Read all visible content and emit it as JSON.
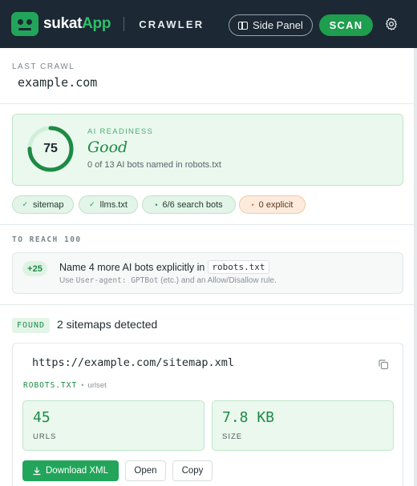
{
  "header": {
    "brand_prefix": "sukat",
    "brand_suffix": "App",
    "section_title": "CRAWLER",
    "side_panel_label": "Side Panel",
    "scan_label": "SCAN",
    "icons": [
      "robot-logo-icon",
      "side-panel-icon",
      "gear-icon"
    ],
    "accent_color": "#22a55a",
    "background_color": "#1c2833"
  },
  "last_crawl": {
    "label": "LAST CRAWL",
    "value": "example.com"
  },
  "readiness": {
    "score": "75",
    "score_fraction": 0.75,
    "label": "AI READINESS",
    "rating": "Good",
    "detail": "0 of 13 AI bots named in robots.txt"
  },
  "chips": [
    {
      "mark": "✓",
      "label": "sitemap",
      "status": "ok"
    },
    {
      "mark": "✓",
      "label": "llms.txt",
      "status": "ok"
    },
    {
      "mark": "•",
      "label": "6/6 search bots",
      "status": "ok"
    },
    {
      "mark": "•",
      "label": "0 explicit",
      "status": "warn"
    }
  ],
  "reach": {
    "label": "TO REACH 100",
    "points": "+25",
    "text": "Name 4 more AI bots explicitly in",
    "code": "robots.txt",
    "hint_prefix": "Use ",
    "hint_code": "User-agent: GPTBot",
    "hint_suffix": " (etc.) and an Allow/Disallow rule."
  },
  "sitemaps": {
    "badge": "FOUND",
    "title": "2 sitemaps detected",
    "items": [
      {
        "url": "https://example.com/sitemap.xml",
        "source": "ROBOTS.TXT",
        "type": "urlset",
        "urls_value": "45",
        "urls_label": "URLS",
        "size_value": "7.8 KB",
        "size_label": "SIZE",
        "download_label": "Download XML",
        "open_label": "Open",
        "copy_label": "Copy"
      }
    ]
  }
}
